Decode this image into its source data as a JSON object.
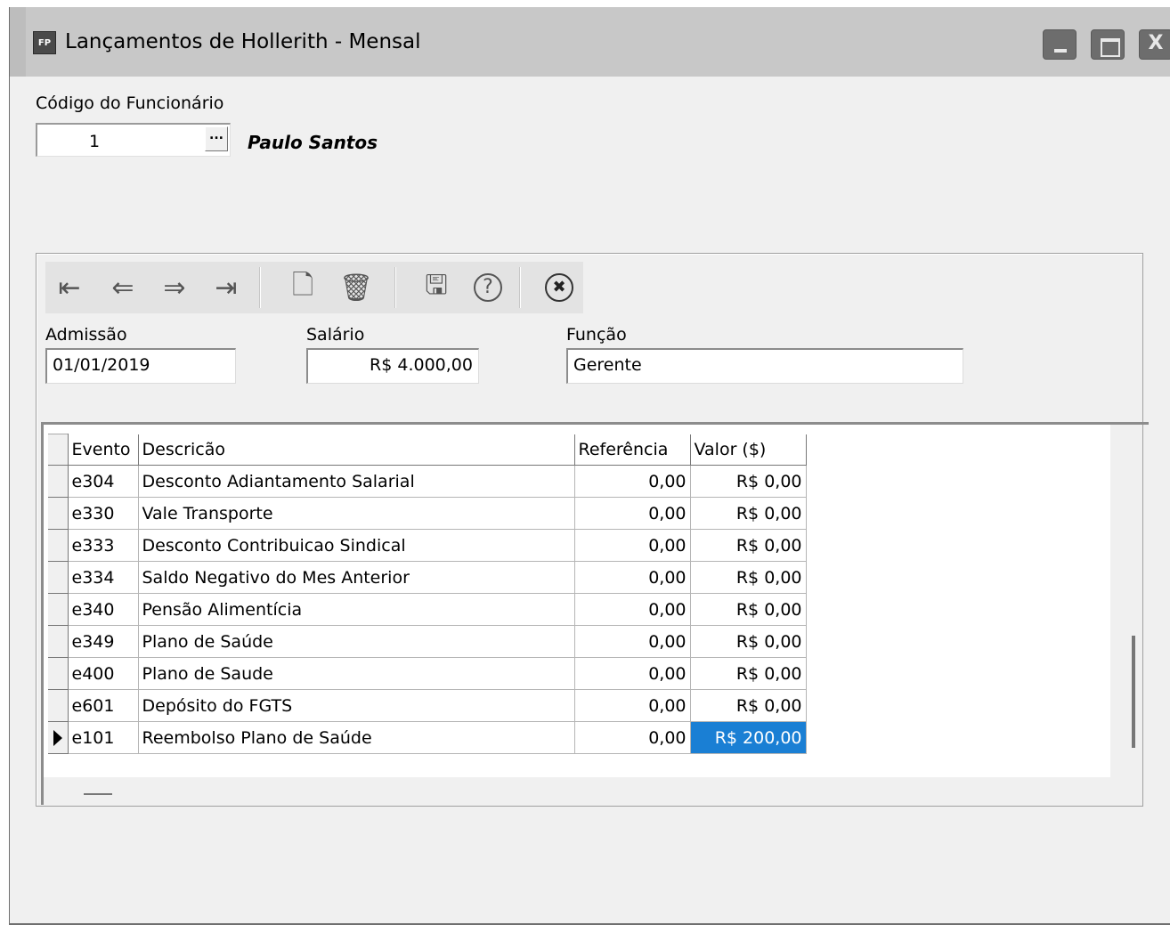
{
  "window": {
    "icon_text": "FP",
    "title": "Lançamentos de Hollerith - Mensal",
    "close_glyph": "X"
  },
  "employee": {
    "code_label": "Código do Funcionário",
    "code_value": "1",
    "lookup_button": "...",
    "name": "Paulo Santos"
  },
  "toolbar": {
    "first": "⇤",
    "prev": "⇐",
    "next": "⇒",
    "last": "⇥",
    "new": "🗋",
    "delete": "🗑",
    "save": "🖫",
    "help": "?",
    "cancel": "✖"
  },
  "fields": {
    "admissao_label": "Admissão",
    "admissao_value": "01/01/2019",
    "salario_label": "Salário",
    "salario_value": "R$ 4.000,00",
    "funcao_label": "Função",
    "funcao_value": "Gerente"
  },
  "grid": {
    "columns": [
      "Evento",
      "Descricão",
      "Referência",
      "Valor ($)"
    ],
    "rows": [
      {
        "evento": "e304",
        "descricao": "Desconto Adiantamento Salarial",
        "referencia": "0,00",
        "valor": "R$ 0,00"
      },
      {
        "evento": "e330",
        "descricao": "Vale Transporte",
        "referencia": "0,00",
        "valor": "R$ 0,00"
      },
      {
        "evento": "e333",
        "descricao": "Desconto Contribuicao Sindical",
        "referencia": "0,00",
        "valor": "R$ 0,00"
      },
      {
        "evento": "e334",
        "descricao": "Saldo Negativo do Mes Anterior",
        "referencia": "0,00",
        "valor": "R$ 0,00"
      },
      {
        "evento": "e340",
        "descricao": "Pensão Alimentícia",
        "referencia": "0,00",
        "valor": "R$ 0,00"
      },
      {
        "evento": "e349",
        "descricao": "Plano de Saúde",
        "referencia": "0,00",
        "valor": "R$ 0,00"
      },
      {
        "evento": "e400",
        "descricao": "Plano de Saude",
        "referencia": "0,00",
        "valor": "R$ 0,00"
      },
      {
        "evento": "e601",
        "descricao": "Depósito do FGTS",
        "referencia": "0,00",
        "valor": "R$ 0,00"
      },
      {
        "evento": "e101",
        "descricao": "Reembolso Plano de Saúde",
        "referencia": "0,00",
        "valor": "R$ 200,00"
      }
    ],
    "selected_row": 8,
    "selected_color": "#1a7fd4"
  }
}
